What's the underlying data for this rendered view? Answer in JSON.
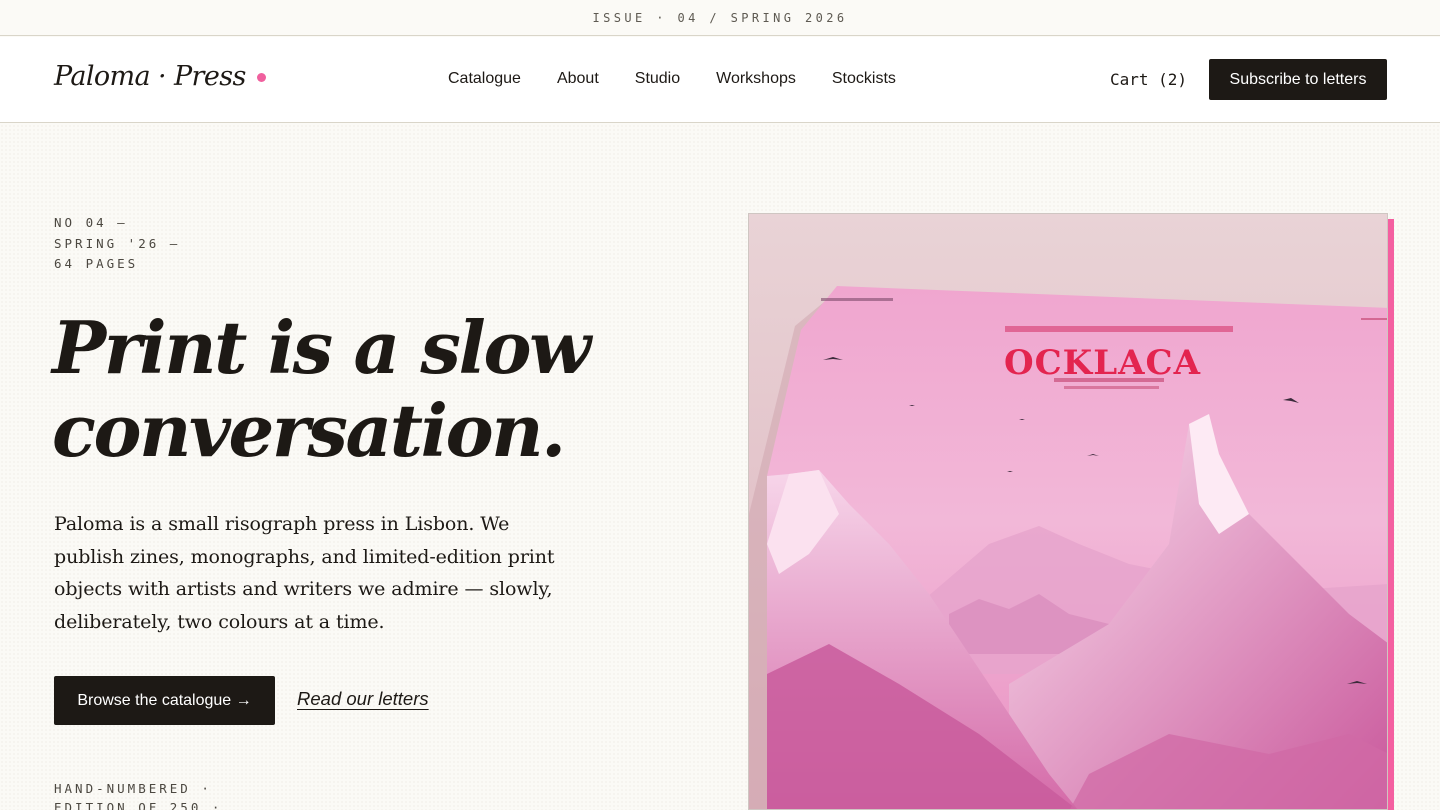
{
  "announcement": "ISSUE · 04 / SPRING 2026",
  "nav": {
    "logo": "Paloma · Press",
    "links": [
      "Catalogue",
      "About",
      "Studio",
      "Workshops",
      "Stockists"
    ],
    "cart": "Cart (2)",
    "subscribe": "Subscribe to letters"
  },
  "hero": {
    "meta": [
      "NO 04 —",
      "SPRING '26 —",
      "64 PAGES"
    ],
    "headline": [
      "Print is a slow",
      "conversation."
    ],
    "lede": "Paloma is a small risograph press in Lisbon. We publish zines, monographs, and limited-edition print objects with artists and writers we admire — slowly, deliberately, two colours at a time.",
    "primary_cta": "Browse the catalogue →",
    "secondary_cta": "Read our letters",
    "edition": [
      "HAND-NUMBERED ·",
      "EDITION OF 250 ·"
    ]
  },
  "cover": {
    "title": "OCKLACA"
  },
  "colors": {
    "accent_pink": "#f0609e",
    "ink": "#1d1915",
    "paper": "#fbfaf6"
  }
}
